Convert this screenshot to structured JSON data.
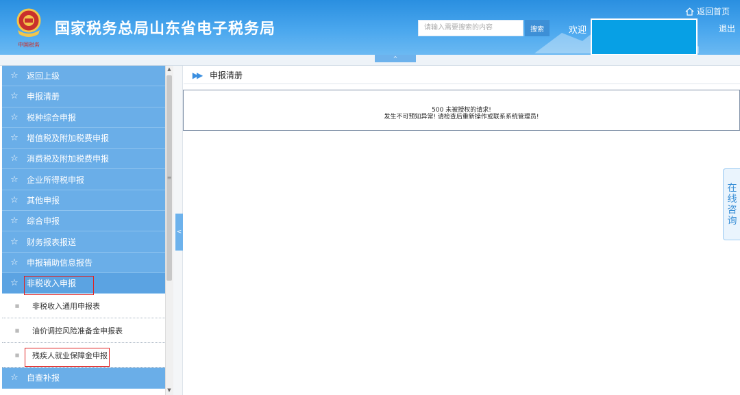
{
  "header": {
    "title": "国家税务总局山东省电子税务局",
    "emblem_caption": "中国税务",
    "search_placeholder": "请输入需要搜索的内容",
    "search_label": "搜索",
    "welcome": "欢迎",
    "home_label": "返回首页",
    "logout_label": "退出",
    "colors": {
      "header": "#2a8fe0",
      "user_box": "#07a0e5"
    }
  },
  "collapse_tab": "^",
  "sidebar": {
    "items": [
      {
        "label": "返回上级",
        "icon": "star-outline-icon"
      },
      {
        "label": "申报清册",
        "icon": "star-outline-icon"
      },
      {
        "label": "税种综合申报",
        "icon": "star-outline-icon"
      },
      {
        "label": "增值税及附加税费申报",
        "icon": "star-outline-icon"
      },
      {
        "label": "消费税及附加税费申报",
        "icon": "star-outline-icon"
      },
      {
        "label": "企业所得税申报",
        "icon": "star-outline-icon"
      },
      {
        "label": "其他申报",
        "icon": "star-outline-icon"
      },
      {
        "label": "综合申报",
        "icon": "star-outline-icon"
      },
      {
        "label": "财务报表报送",
        "icon": "star-outline-icon"
      },
      {
        "label": "申报辅助信息报告",
        "icon": "star-outline-icon"
      },
      {
        "label": "非税收入申报",
        "icon": "star-outline-icon"
      }
    ],
    "sub_items": [
      {
        "label": "非税收入通用申报表"
      },
      {
        "label": "油价调控风险准备金申报表"
      },
      {
        "label": "残疾人就业保障金申报"
      }
    ],
    "bottom_item": {
      "label": "自查补报",
      "icon": "star-outline-icon"
    },
    "colors": {
      "item_bg": "#6aaee8",
      "highlight": "#e02020"
    }
  },
  "divider_handle": "<",
  "main": {
    "breadcrumb": "申报清册",
    "error_line1": "500 未被授权的请求!",
    "error_line2": "发生不可预知异常! 请检查后重新操作或联系系统管理员!"
  },
  "consult": {
    "chars": [
      "在",
      "线",
      "咨",
      "询"
    ]
  }
}
